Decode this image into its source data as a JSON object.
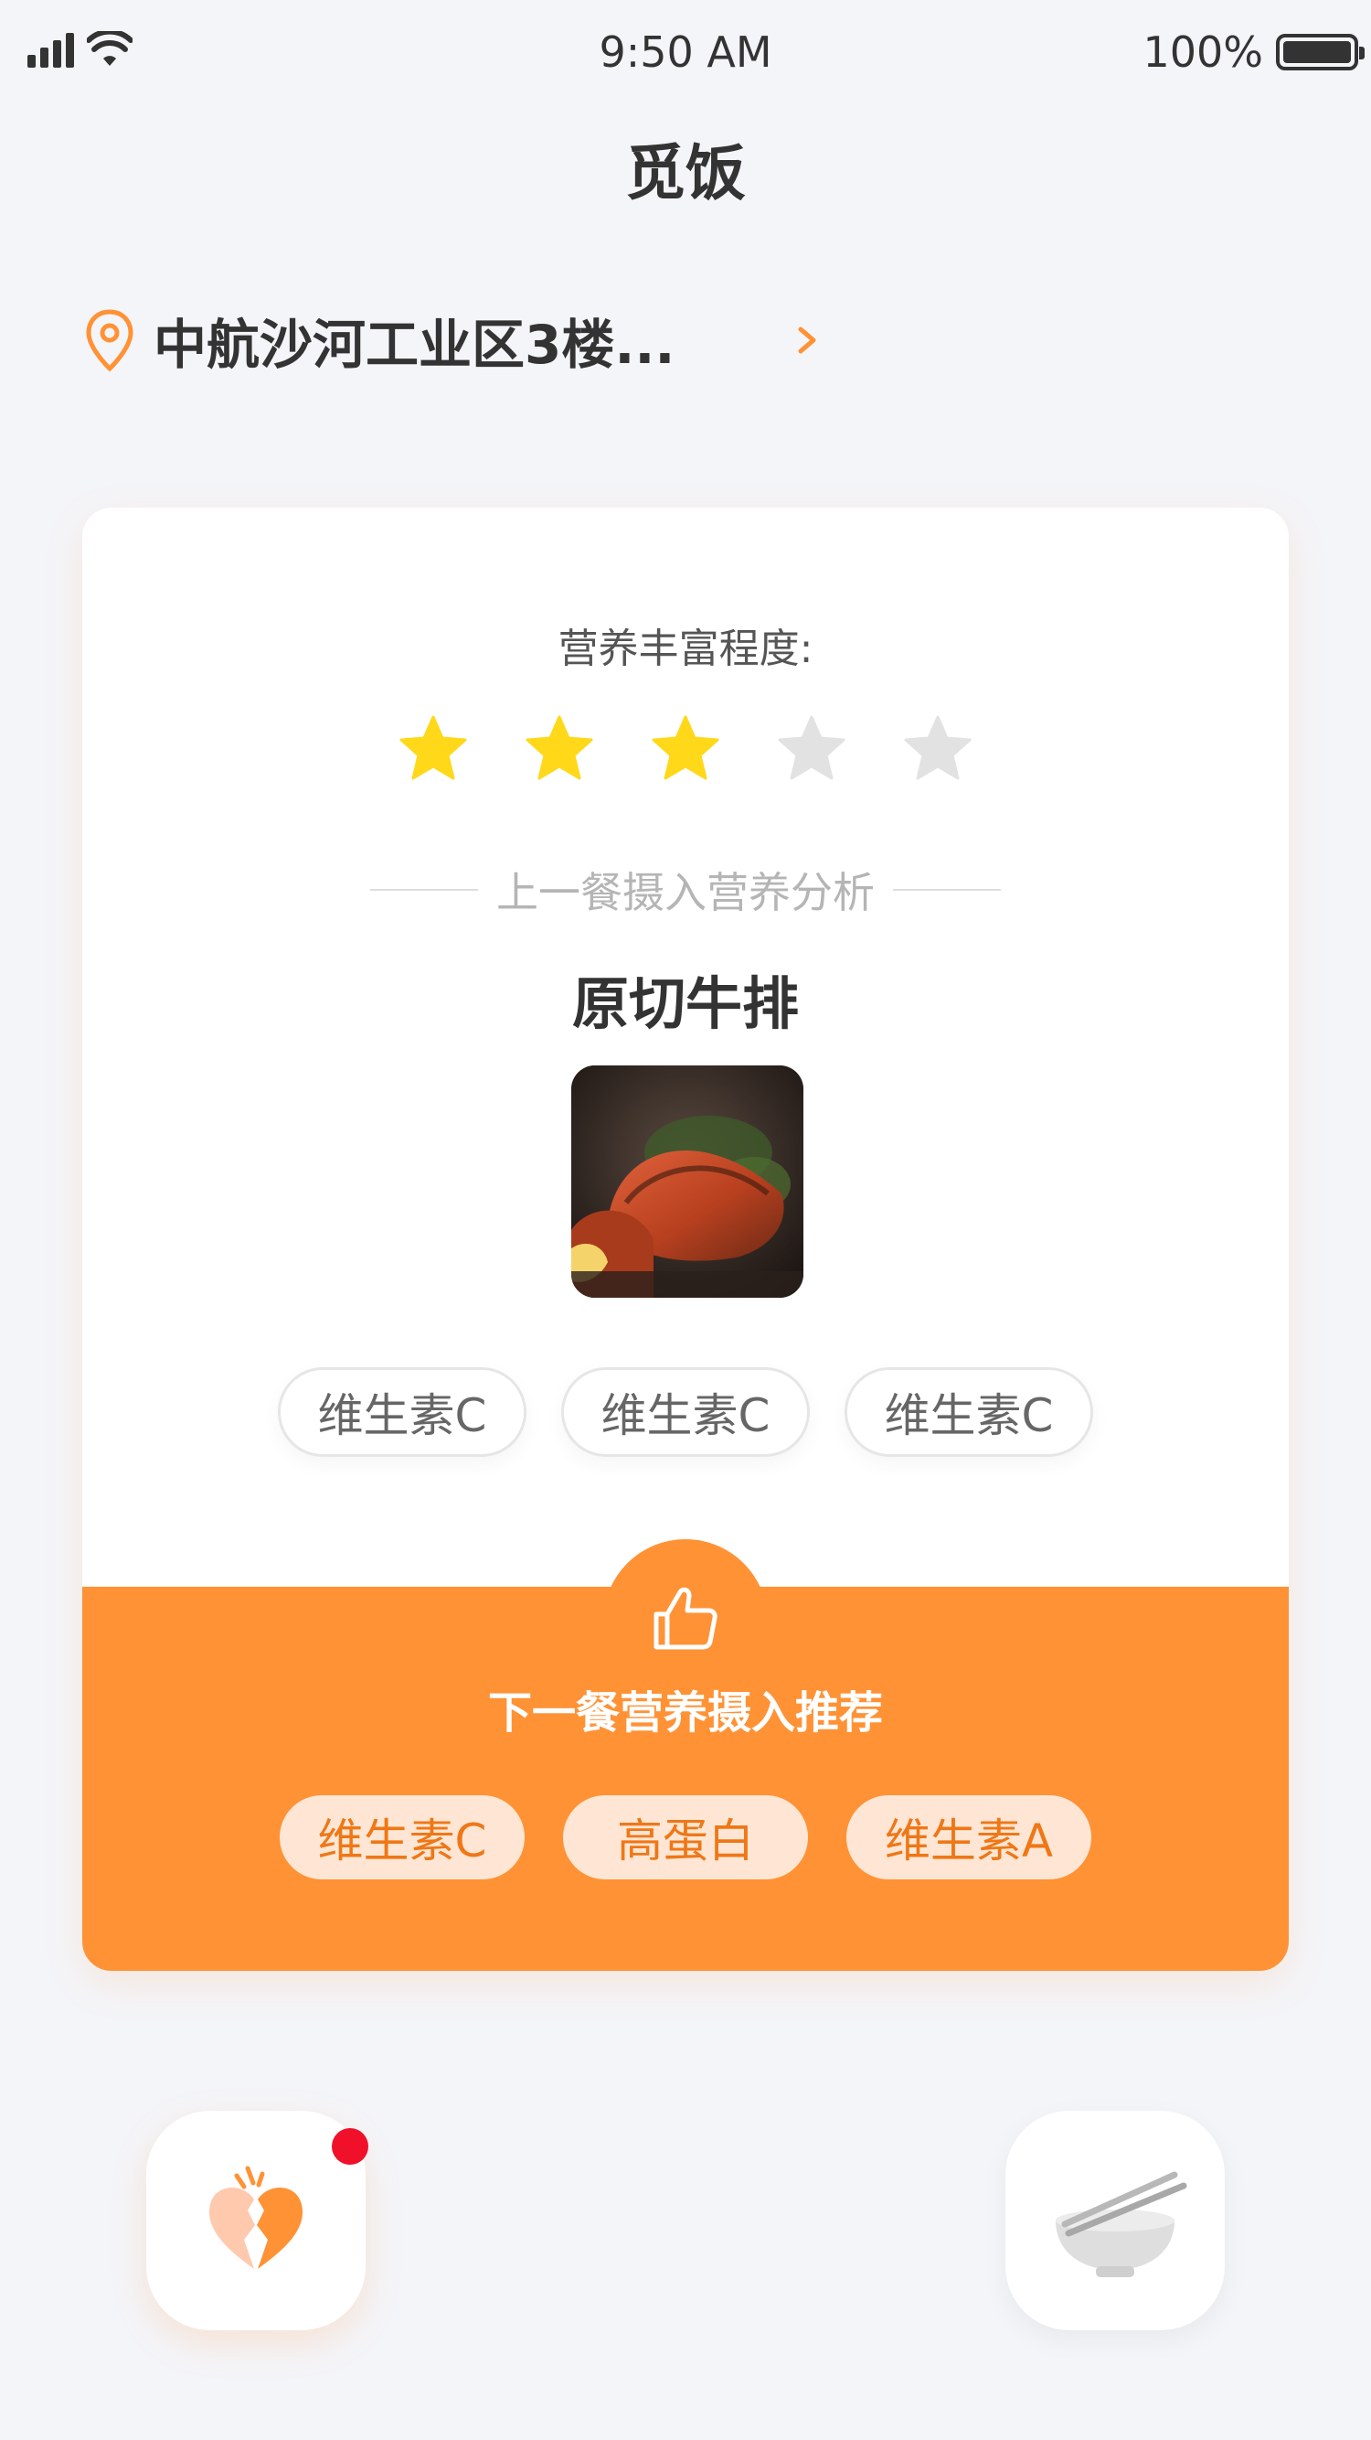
{
  "status_bar": {
    "time": "9:50 AM",
    "battery": "100%",
    "icons": [
      "signal-icon",
      "wifi-icon",
      "battery-icon"
    ]
  },
  "header": {
    "title": "觅饭"
  },
  "location": {
    "address": "中航沙河工业区3楼...",
    "icons": [
      "location-pin-icon",
      "chevron-right-icon"
    ]
  },
  "card": {
    "rating_label": "营养丰富程度:",
    "rating": {
      "value": 3,
      "max": 5
    },
    "section_heading": "上一餐摄入营养分析",
    "dish_name": "原切牛排",
    "nutrient_tags": [
      "维生素C",
      "维生素C",
      "维生素C"
    ],
    "recommendation": {
      "icon": "thumbs-up-icon",
      "title": "下一餐营养摄入推荐",
      "tags": [
        "维生素C",
        "高蛋白",
        "维生素A"
      ]
    }
  },
  "bottom_actions": {
    "left_icon": "broken-heart-icon",
    "right_icon": "bowl-chopsticks-icon",
    "left_has_notification": true
  },
  "colors": {
    "accent": "#ff9235",
    "star_on": "#ffd81a",
    "star_off": "#e2e2e2",
    "tag_text": "#ef7716",
    "notification": "#f0102a",
    "background": "#f4f5f9"
  }
}
